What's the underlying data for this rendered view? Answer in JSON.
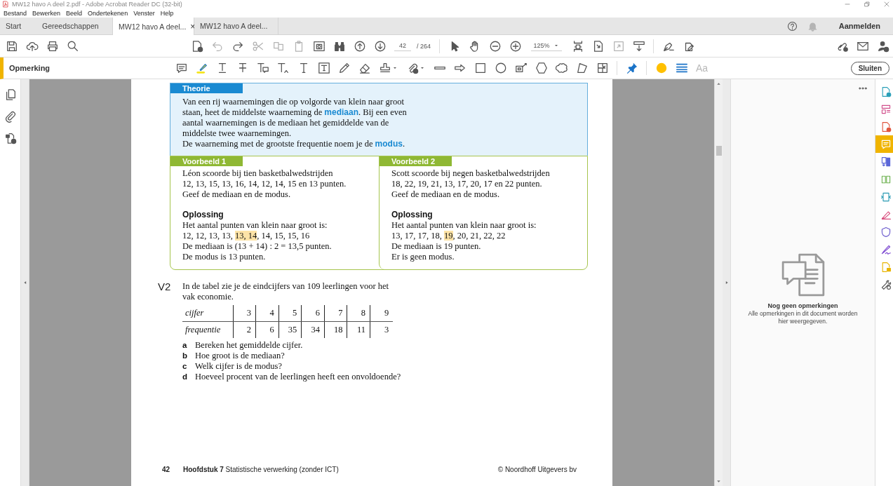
{
  "window": {
    "title": "MW12 havo A deel 2.pdf - Adobe Acrobat Reader DC (32-bit)"
  },
  "menu": [
    "Bestand",
    "Bewerken",
    "Beeld",
    "Ondertekenen",
    "Venster",
    "Help"
  ],
  "tabs": [
    {
      "label": "Start",
      "selected": false
    },
    {
      "label": "Gereedschappen",
      "selected": false
    },
    {
      "label": "MW12 havo A deel...",
      "selected": true,
      "close": "×"
    },
    {
      "label": "MW12 havo A deel...",
      "selected": false
    }
  ],
  "account": {
    "label": "Aanmelden"
  },
  "toolbar": {
    "page": "42",
    "page_total": "/ 264",
    "zoom": "125%"
  },
  "comment_bar": {
    "title": "Opmerking",
    "text_properties": "Aa",
    "close": "Sluiten"
  },
  "document": {
    "theory": {
      "label": "Theorie",
      "paragraphs": [
        "Van een rij waarnemingen die op volgorde van klein naar groot\nstaan, heet de middelste waarneming de **mediaan**. Bij een even\naantal waarnemingen is de mediaan het gemiddelde van de\nmiddelste twee waarnemingen.",
        "De waarneming met de grootste frequentie noem je de **modus**."
      ]
    },
    "examples": [
      {
        "label": "Voorbeeld 1",
        "question": "Léon scoorde bij tien basketbalwedstrijden\n12, 13, 15, 13, 16, 14, 12, 14, 15 en 13 punten.\nGeef de mediaan en de modus.",
        "solution_title": "Oplossing",
        "solution": "Het aantal punten van klein naar groot is:\n12, 12, 13, 13, **13, 14**, 14, 15, 15, 16\nDe mediaan is (13 + 14) : 2 = 13,5 punten.\nDe modus is 13 punten."
      },
      {
        "label": "Voorbeeld 2",
        "question": "Scott scoorde bij negen basketbalwedstrijden\n18, 22, 19, 21, 13, 17, 20, 17 en 22 punten.\nGeef de mediaan en de modus.",
        "solution_title": "Oplossing",
        "solution": "Het aantal punten van klein naar groot is:\n13, 17, 17, 18, **19**, 20, 21, 22, 22\nDe mediaan is 19 punten.\nEr is geen modus."
      }
    ],
    "exercise": {
      "number": "V2",
      "text": "In de tabel zie je de eindcijfers van 109 leerlingen voor het\nvak economie.",
      "table": [
        {
          "label": "cijfer",
          "values": [
            "3",
            "4",
            "5",
            "6",
            "7",
            "8",
            "9"
          ]
        },
        {
          "label": "frequentie",
          "values": [
            "2",
            "6",
            "35",
            "34",
            "18",
            "11",
            "3"
          ]
        }
      ],
      "questions": [
        {
          "letter": "a",
          "text": "Bereken het gemiddelde cijfer."
        },
        {
          "letter": "b",
          "text": "Hoe groot is de mediaan?"
        },
        {
          "letter": "c",
          "text": "Welk cijfer is de modus?"
        },
        {
          "letter": "d",
          "text": "Hoeveel procent van de leerlingen heeft een onvoldoende?"
        }
      ]
    },
    "footer": {
      "page": "42",
      "chapter": "**Hoofdstuk 7** Statistische verwerking (zonder ICT)",
      "copyright": "© Noordhoff Uitgevers bv"
    }
  },
  "comments_panel": {
    "title": "Nog geen opmerkingen",
    "message": "Alle opmerkingen in dit document worden\nhier weergegeven."
  },
  "tools": [
    {
      "selected": false
    },
    {
      "selected": false
    },
    {
      "selected": false
    },
    {
      "selected": true
    },
    {
      "selected": false
    },
    {
      "selected": false
    },
    {
      "selected": false
    },
    {
      "selected": false
    },
    {
      "selected": false
    },
    {
      "selected": false
    },
    {
      "selected": false
    },
    {
      "selected": false
    }
  ]
}
